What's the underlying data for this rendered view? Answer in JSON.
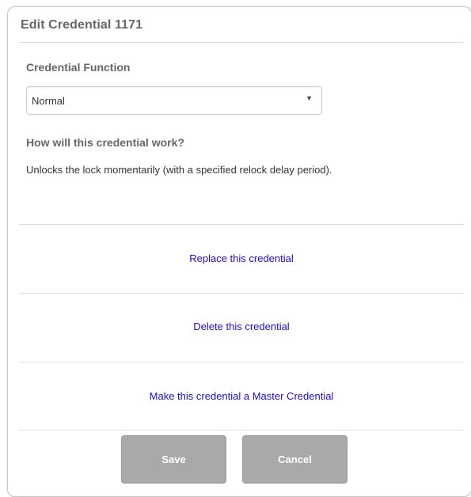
{
  "dialog": {
    "title": "Edit Credential 1171",
    "function_label": "Credential Function",
    "function_select": {
      "selected": "Normal",
      "arrow_icon": "triangle-down-icon"
    },
    "how_label": "How will this credential work?",
    "description": "Unlocks the lock momentarily (with a specified relock delay period).",
    "actions": {
      "replace": "Replace this credential",
      "delete": "Delete this credential",
      "make_master": "Make this credential a Master Credential"
    },
    "buttons": {
      "save": "Save",
      "cancel": "Cancel"
    }
  },
  "colors": {
    "link": "#1a0dd9",
    "button_bg": "#a9a9a9",
    "label_text": "#666666"
  }
}
